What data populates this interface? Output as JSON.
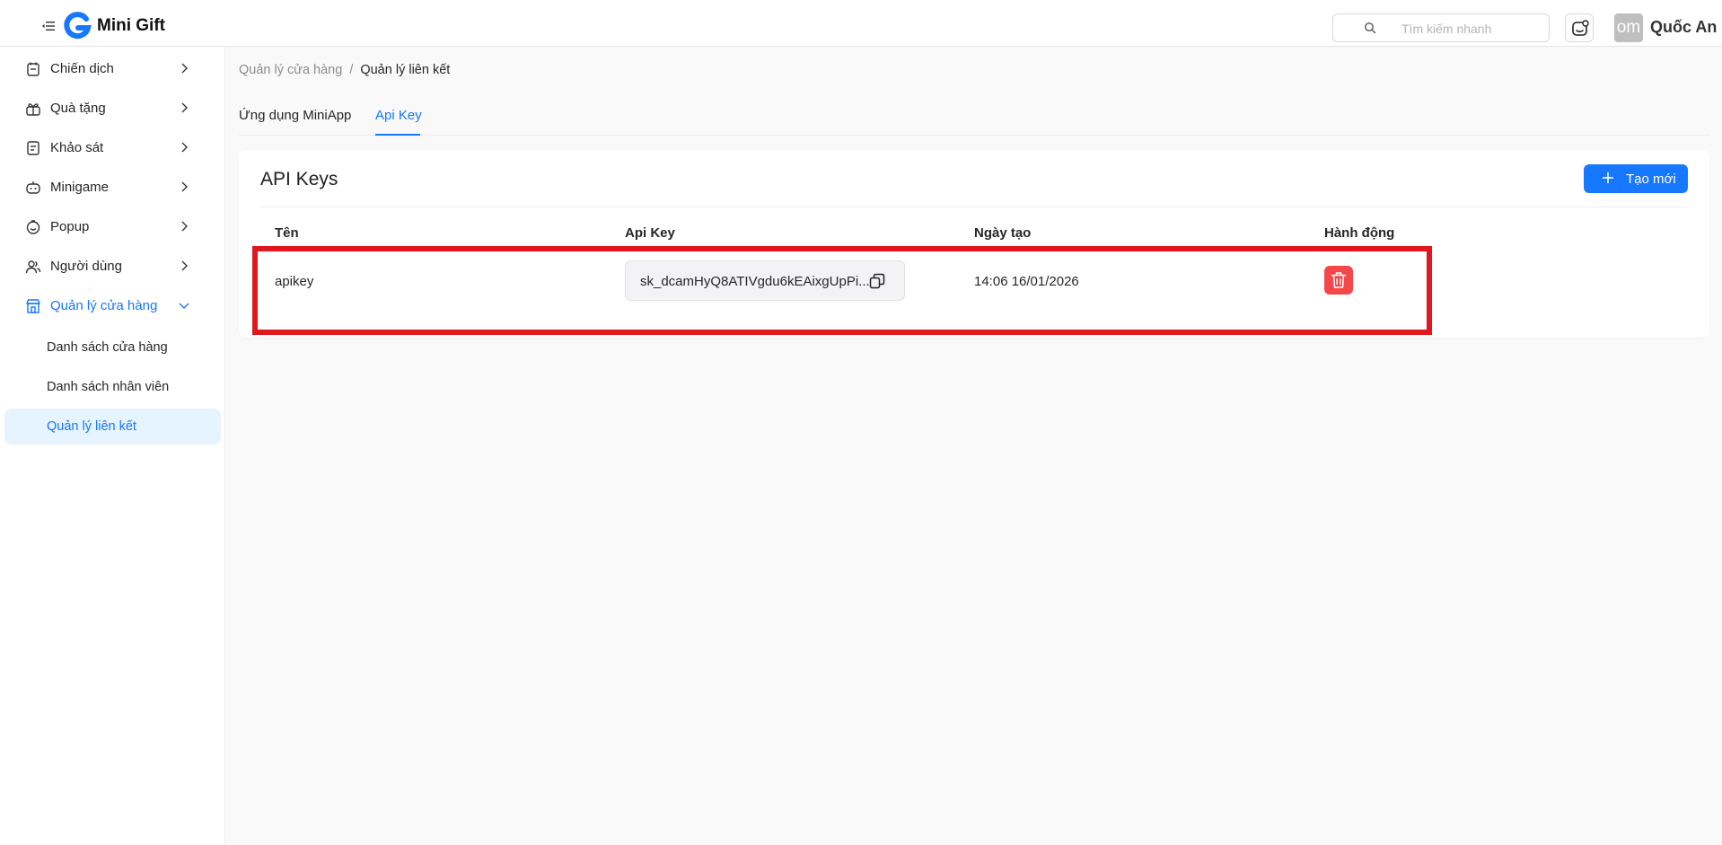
{
  "header": {
    "app_name": "Mini Gift",
    "search_placeholder": "Tìm kiếm nhanh",
    "avatar_initials": "om",
    "user_name": "Quốc An"
  },
  "sidebar": {
    "items": [
      {
        "label": "Chiến dịch",
        "icon": "campaign-icon"
      },
      {
        "label": "Quà tặng",
        "icon": "gift-icon"
      },
      {
        "label": "Khảo sát",
        "icon": "survey-icon"
      },
      {
        "label": "Minigame",
        "icon": "game-icon"
      },
      {
        "label": "Popup",
        "icon": "popup-icon"
      },
      {
        "label": "Người dùng",
        "icon": "users-icon"
      },
      {
        "label": "Quản lý cửa hàng",
        "icon": "store-icon",
        "expanded": true
      }
    ],
    "sub_items": [
      {
        "label": "Danh sách cửa hàng"
      },
      {
        "label": "Danh sách nhân viên"
      },
      {
        "label": "Quản lý liên kết",
        "selected": true
      }
    ]
  },
  "breadcrumb": {
    "parent": "Quản lý cửa hàng",
    "separator": "/",
    "current": "Quản lý liên kết"
  },
  "tabs": [
    {
      "label": "Ứng dụng MiniApp"
    },
    {
      "label": "Api Key",
      "active": true
    }
  ],
  "card": {
    "title": "API Keys",
    "create_button": "Tạo mới"
  },
  "table": {
    "columns": [
      "Tên",
      "Api Key",
      "Ngày tạo",
      "Hành động"
    ],
    "rows": [
      {
        "name": "apikey",
        "api_key": "sk_dcamHyQ8ATIVgdu6kEAixgUpPi...",
        "created": "14:06 16/01/2026"
      }
    ]
  },
  "colors": {
    "accent": "#1677ff",
    "danger": "#f5474a",
    "highlight": "#e0181e"
  }
}
